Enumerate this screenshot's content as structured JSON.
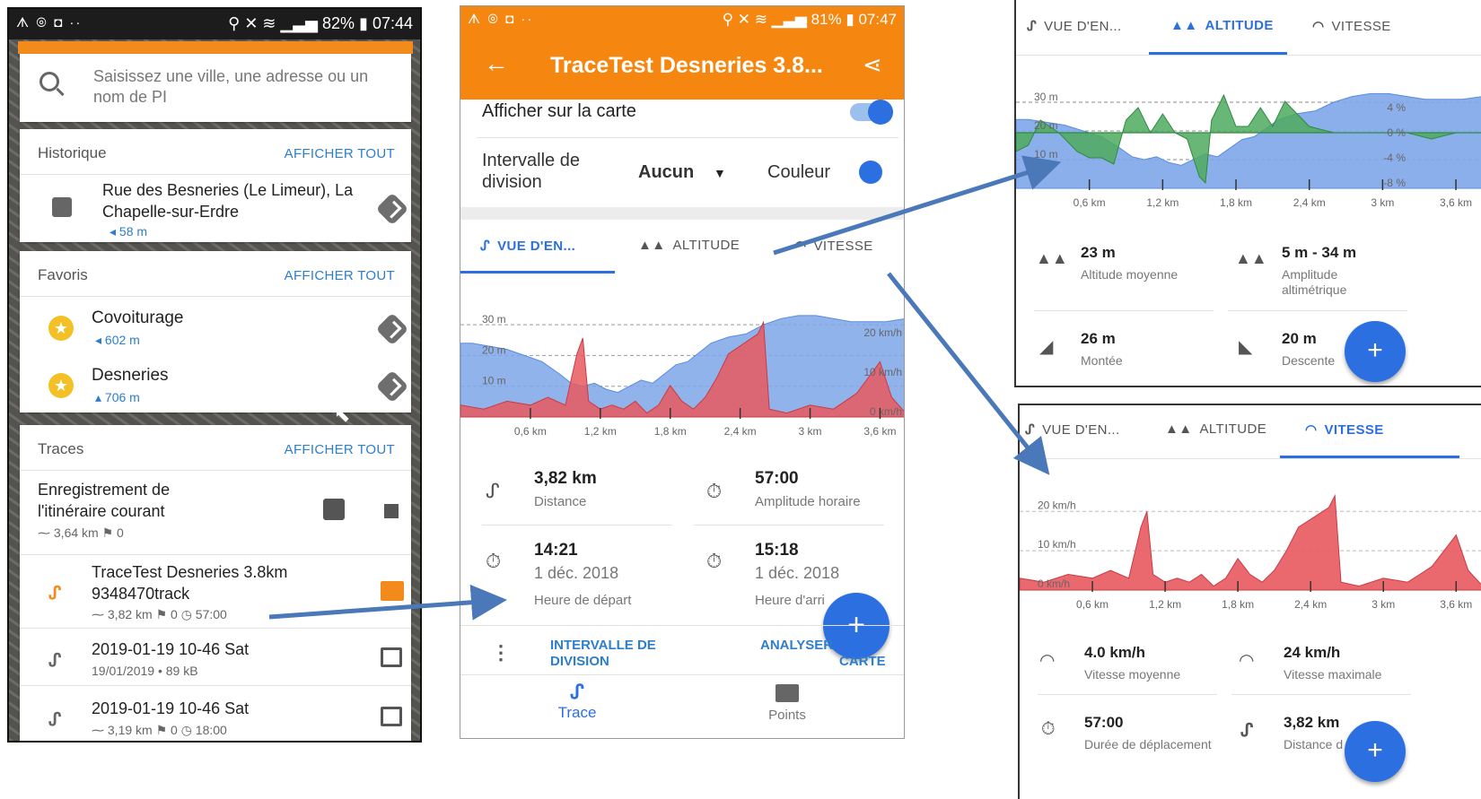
{
  "status1": {
    "left": "ᗑ ⊚ ◘ ··",
    "right": "⚲ ✕ ≋ ▁▃▅ 82% ▮ 07:44"
  },
  "search": {
    "placeholder": "Saisissez une ville, une adresse ou un nom de PI"
  },
  "historique": {
    "title": "Historique",
    "action": "AFFICHER TOUT",
    "item": {
      "name": "Rue des Besneries (Le Limeur), La Chapelle-sur-Erdre",
      "distance": "◂ 58 m"
    }
  },
  "favoris": {
    "title": "Favoris",
    "action": "AFFICHER TOUT",
    "items": [
      {
        "name": "Covoiturage",
        "distance": "◂ 602 m"
      },
      {
        "name": "Desneries",
        "distance": "▴ 706 m"
      }
    ]
  },
  "traces": {
    "title": "Traces",
    "action": "AFFICHER TOUT",
    "recording": {
      "name": "Enregistrement de l'itinéraire courant",
      "meta": "⁓ 3,64 km    ⚑ 0"
    },
    "items": [
      {
        "name": "TraceTest Desneries 3.8km 9348470track",
        "meta": "⁓ 3,82 km    ⚑ 0    ◷ 57:00"
      },
      {
        "name": "2019-01-19 10-46 Sat",
        "meta": "19/01/2019 • 89 kB"
      },
      {
        "name": "2019-01-19 10-46 Sat",
        "meta": "⁓ 3,19 km    ⚑ 0    ◷ 18:00"
      }
    ]
  },
  "status2": {
    "left": "ᗑ ⊚ ◘ ··",
    "right": "⚲ ✕ ≋ ▁▃▅ 81% ▮ 07:47"
  },
  "detail": {
    "title": "TraceTest Desneries 3.8...",
    "show_on_map": "Afficher sur la carte",
    "interval_label": "Intervalle de division",
    "interval_value": "Aucun",
    "color_label": "Couleur",
    "tabs": [
      "VUE D'EN...",
      "ALTITUDE",
      "VITESSE"
    ],
    "stats": [
      {
        "value": "3,82 km",
        "label": "Distance"
      },
      {
        "value": "57:00",
        "label": "Amplitude horaire"
      },
      {
        "value": "14:21",
        "date": "1 déc. 2018",
        "label": "Heure de départ"
      },
      {
        "value": "15:18",
        "date": "1 déc. 2018",
        "label": "Heure d'arri"
      }
    ],
    "actions": [
      "INTERVALLE DE DIVISION",
      "ANALYSER",
      "CARTE"
    ],
    "bottom_nav": [
      "Trace",
      "Points"
    ],
    "fab": "+"
  },
  "altitude_panel": {
    "tabs": [
      "VUE D'EN...",
      "ALTITUDE",
      "VITESSE"
    ],
    "stats": [
      {
        "value": "23 m",
        "label": "Altitude moyenne"
      },
      {
        "value": "5 m - 34 m",
        "label": "Amplitude altimétrique"
      },
      {
        "value": "26 m",
        "label": "Montée"
      },
      {
        "value": "20 m",
        "label": "Descente"
      }
    ],
    "fab": "+"
  },
  "speed_panel": {
    "tabs": [
      "VUE D'EN...",
      "ALTITUDE",
      "VITESSE"
    ],
    "stats": [
      {
        "value": "4.0 km/h",
        "label": "Vitesse moyenne"
      },
      {
        "value": "24 km/h",
        "label": "Vitesse maximale"
      },
      {
        "value": "57:00",
        "label": "Durée de déplacement"
      },
      {
        "value": "3,82 km",
        "label": "Distance d"
      }
    ],
    "fab": "+"
  },
  "chart_data": [
    {
      "type": "area",
      "x_tick_labels": [
        "0,6 km",
        "1,2 km",
        "1,8 km",
        "2,4 km",
        "3 km",
        "3,6 km"
      ],
      "xlim": [
        0,
        3.82
      ],
      "left_axis_labels": [
        "30 m",
        "20 m",
        "10 m"
      ],
      "right_axis_labels": [
        "20 km/h",
        "10 km/h",
        "0 km/h"
      ],
      "series": [
        {
          "x": [
            0,
            0.1,
            0.25,
            0.4,
            0.55,
            0.7,
            0.85,
            0.95,
            1.05,
            1.15,
            1.25,
            1.35,
            1.45,
            1.55,
            1.65,
            1.75,
            1.85,
            1.95,
            2.05,
            2.15,
            2.3,
            2.45,
            2.6,
            2.75,
            2.9,
            3.05,
            3.2,
            3.35,
            3.5,
            3.65,
            3.82
          ],
          "values": [
            24,
            24,
            23,
            22,
            20,
            18,
            14,
            11,
            10,
            11,
            9,
            8,
            10,
            12,
            11,
            14,
            17,
            18,
            21,
            24,
            26,
            27,
            30,
            32,
            33,
            33,
            32,
            31,
            31,
            31,
            32
          ]
        },
        {
          "x": [
            0,
            0.2,
            0.4,
            0.6,
            0.75,
            0.9,
            1.0,
            1.05,
            1.1,
            1.2,
            1.3,
            1.4,
            1.5,
            1.6,
            1.7,
            1.8,
            1.9,
            2.0,
            2.1,
            2.2,
            2.3,
            2.55,
            2.6,
            2.65,
            2.8,
            3.0,
            3.2,
            3.3,
            3.4,
            3.5,
            3.6,
            3.7,
            3.82
          ],
          "values": [
            3,
            2,
            4,
            3,
            5,
            3,
            16,
            20,
            4,
            2,
            3,
            2,
            4,
            1,
            3,
            8,
            4,
            2,
            5,
            10,
            16,
            21,
            24,
            2,
            1,
            3,
            2,
            4,
            6,
            10,
            14,
            5,
            1
          ]
        }
      ]
    },
    {
      "type": "area",
      "x_tick_labels": [
        "0,6 km",
        "1,2 km",
        "1,8 km",
        "2,4 km",
        "3 km",
        "3,6 km"
      ],
      "xlim": [
        0,
        3.82
      ],
      "left_axis_labels": [
        "30 m",
        "20 m",
        "10 m"
      ],
      "right_axis_labels": [
        "4 %",
        "0 %",
        "-4 %",
        "-8 %"
      ],
      "series": [
        {
          "x": [
            0,
            0.1,
            0.25,
            0.4,
            0.55,
            0.7,
            0.85,
            0.95,
            1.05,
            1.15,
            1.25,
            1.35,
            1.45,
            1.55,
            1.65,
            1.75,
            1.85,
            1.95,
            2.05,
            2.15,
            2.3,
            2.45,
            2.6,
            2.75,
            2.9,
            3.05,
            3.2,
            3.35,
            3.5,
            3.65,
            3.82
          ],
          "values": [
            24,
            24,
            23,
            22,
            20,
            18,
            14,
            11,
            10,
            11,
            9,
            8,
            10,
            12,
            11,
            14,
            17,
            18,
            21,
            24,
            26,
            27,
            30,
            32,
            33,
            33,
            32,
            31,
            31,
            31,
            32
          ]
        },
        {
          "x": [
            0,
            0.1,
            0.2,
            0.35,
            0.5,
            0.6,
            0.7,
            0.8,
            0.9,
            1.0,
            1.1,
            1.2,
            1.3,
            1.4,
            1.5,
            1.55,
            1.6,
            1.7,
            1.8,
            1.9,
            2.0,
            2.1,
            2.2,
            2.4,
            2.6,
            2.8,
            3.0,
            3.2,
            3.4,
            3.6,
            3.82
          ],
          "values": [
            -3,
            -2,
            2,
            0,
            -3,
            -4,
            -4,
            -5,
            2,
            4,
            0,
            3,
            0,
            -1,
            -7,
            -8,
            2,
            6,
            1,
            1,
            4,
            1,
            5,
            1,
            0,
            0,
            0,
            0,
            -1,
            0,
            0
          ]
        }
      ]
    },
    {
      "type": "area",
      "x_tick_labels": [
        "0,6 km",
        "1,2 km",
        "1,8 km",
        "2,4 km",
        "3 km",
        "3,6 km"
      ],
      "xlim": [
        0,
        3.82
      ],
      "left_axis_labels": [
        "20 km/h",
        "10 km/h",
        "0 km/h"
      ],
      "series": [
        {
          "x": [
            0,
            0.2,
            0.4,
            0.6,
            0.75,
            0.9,
            1.0,
            1.05,
            1.1,
            1.2,
            1.3,
            1.4,
            1.5,
            1.6,
            1.7,
            1.8,
            1.9,
            2.0,
            2.1,
            2.2,
            2.3,
            2.55,
            2.6,
            2.65,
            2.8,
            3.0,
            3.2,
            3.3,
            3.4,
            3.5,
            3.6,
            3.7,
            3.82
          ],
          "values": [
            3,
            2,
            4,
            3,
            5,
            3,
            16,
            20,
            4,
            2,
            3,
            2,
            4,
            1,
            3,
            8,
            4,
            2,
            5,
            10,
            16,
            21,
            24,
            2,
            1,
            3,
            2,
            4,
            6,
            10,
            14,
            5,
            1
          ]
        }
      ]
    }
  ],
  "colors": {
    "orange": "#f5860f",
    "blue": "#2c6fe0",
    "link": "#2d7ecb",
    "altitude": "#7ea6e8",
    "speed": "#e8595f",
    "slope": "#4daa5e",
    "arrow": "#4a78b8"
  }
}
